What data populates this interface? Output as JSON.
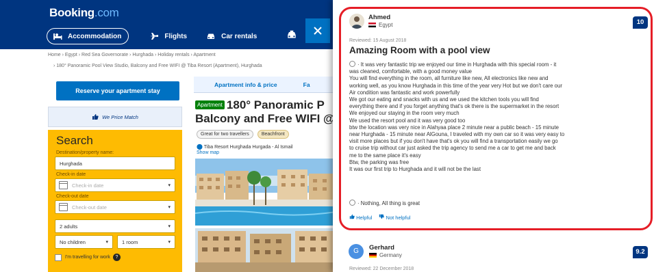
{
  "header": {
    "logo_main": "Booking",
    "logo_tld": ".com",
    "nav": [
      {
        "label": "Accommodation",
        "icon": "bed-icon"
      },
      {
        "label": "Flights",
        "icon": "plane-icon"
      },
      {
        "label": "Car rentals",
        "icon": "car-icon"
      }
    ],
    "extra_icon": "taxi-icon",
    "close_icon": "close-icon"
  },
  "breadcrumb": {
    "line1": "Home  ›  Egypt  ›  Red Sea Governorate  ›  Hurghada  ›  Holiday rentals  ›  Apartment",
    "line2": "›  180° Panoramic Pool View Studio, Balcony and Free WIFI @ Tiba Resort (Apartment), Hurghada"
  },
  "sidebar": {
    "reserve_label": "Reserve your apartment stay",
    "price_match": "We Price Match",
    "search": {
      "title": "Search",
      "destination_label": "Destination/property name:",
      "destination_value": "Hurghada",
      "checkin_label": "Check-in date",
      "checkin_placeholder": "Check-in date",
      "checkout_label": "Check-out date",
      "checkout_placeholder": "Check-out date",
      "adults": "2 adults",
      "children": "No children",
      "rooms": "1 room",
      "work_label": "I'm travelling for work"
    }
  },
  "main": {
    "tab1": "Apartment info & price",
    "tab2": "Fa",
    "badge": "Apartment",
    "title_line1": "180° Panoramic P",
    "title_line2": "Balcony and Free WIFI @",
    "chip1": "Great for two travellers",
    "chip2": "Beachfront",
    "address": "Tiba Resort Hurghada Hurgada - Al Ismail",
    "show_map": "Show map"
  },
  "review": {
    "name": "Ahmed",
    "country": "Egypt",
    "score": "10",
    "reviewed": "Reviewed: 15 August 2018",
    "title": "Amazing Room with a pool view",
    "body_lines": [
      "· It was very fantastic trip we enjoyed our time in Hurghada with this special room - it",
      "was cleaned, comfortable, with a good money value",
      "You will find everything in the room, all furniture like new, All electronics like new and",
      "working well, as you know Hurghada in this time of the year very Hot but we don't care our",
      "Air condition was fantastic and work powerfully",
      "We got our eating and snacks with us and we used the kitchen tools you will find",
      "everything there and if you forget anything that's ok there is the supermarket in the resort",
      "We enjoyed our staying in the room very much",
      "We used the resort pool and it was very good too",
      "btw the location was very nice in Alahyaa place 2 minute near a public beach - 15 minute",
      "near Hurghada - 15 minute near AlGouna, I traveled with my own car so it was very easy to",
      "visit more places but if you don't have that's ok you will find a transportation easily we go",
      "to cruise trip without car just asked the trip agency to send me a car to get me and back",
      "me to the same place it's easy",
      "Btw, the parking was free",
      "It was our first trip to Hurghada and it will not be the last"
    ],
    "negative": "· Nothing, All thing is great",
    "helpful": "Helpful",
    "not_helpful": "Not helpful"
  },
  "review2": {
    "initial": "G",
    "name": "Gerhard",
    "country": "Germany",
    "score": "9.2",
    "reviewed": "Reviewed: 22 December 2018"
  }
}
